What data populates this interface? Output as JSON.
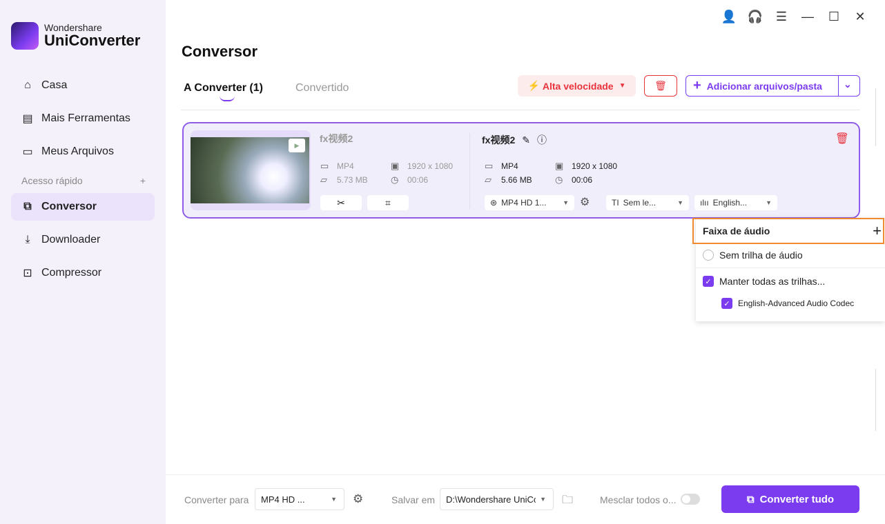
{
  "brand": {
    "line1": "Wondershare",
    "line2": "UniConverter"
  },
  "sidebar": {
    "items": [
      {
        "label": "Casa",
        "icon": "home-icon"
      },
      {
        "label": "Mais Ferramentas",
        "icon": "toolbox-icon"
      },
      {
        "label": "Meus Arquivos",
        "icon": "file-icon"
      }
    ],
    "quick_access": "Acesso rápido",
    "quick_items": [
      {
        "label": "Conversor",
        "icon": "converter-icon",
        "active": true
      },
      {
        "label": "Downloader",
        "icon": "download-icon"
      },
      {
        "label": "Compressor",
        "icon": "compress-icon"
      }
    ]
  },
  "page_title": "Conversor",
  "tabs": [
    {
      "label": "A Converter (1)",
      "active": true
    },
    {
      "label": "Convertido"
    }
  ],
  "toolbar": {
    "speed": "Alta velocidade",
    "add": "Adicionar arquivos/pasta"
  },
  "file": {
    "source": {
      "name": "fx视频2",
      "format": "MP4",
      "size": "5.73 MB",
      "resolution": "1920 x 1080",
      "duration": "00:06"
    },
    "target": {
      "name": "fx视频2",
      "format": "MP4",
      "size": "5.66 MB",
      "resolution": "1920 x 1080",
      "duration": "00:06",
      "preset": "MP4 HD 1...",
      "subtitle": "Sem le...",
      "audio": "English..."
    }
  },
  "audio_popup": {
    "title": "Faixa de áudio",
    "options": [
      {
        "label": "Sem trilha de áudio",
        "type": "radio",
        "checked": false
      },
      {
        "label": "Manter todas as trilhas...",
        "type": "checkbox",
        "checked": true
      },
      {
        "label": "English-Advanced Audio Codec",
        "type": "checkbox",
        "checked": true
      }
    ]
  },
  "bottom": {
    "convert_to_label": "Converter para",
    "convert_to_value": "MP4 HD ...",
    "save_label": "Salvar em",
    "save_value": "D:\\Wondershare UniCo",
    "merge_label": "Mesclar todos o...",
    "merge_on": false,
    "convert_all": "Converter tudo"
  },
  "colors": {
    "accent": "#7b3cf0",
    "danger": "#e8323c",
    "highlight": "#f08a30"
  }
}
